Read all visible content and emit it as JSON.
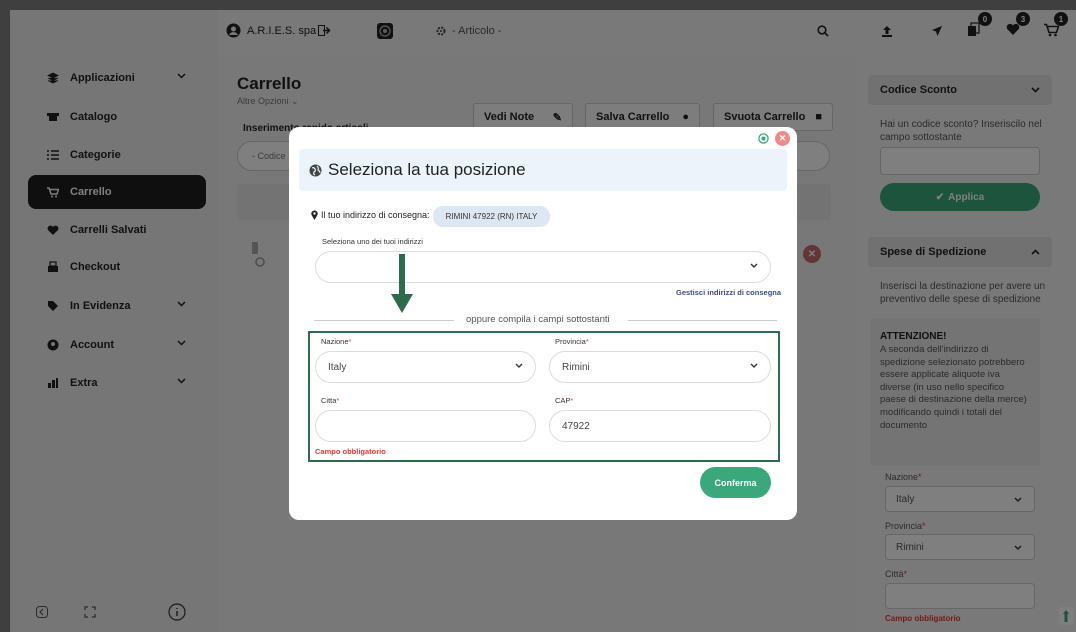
{
  "topbar": {
    "company": "A.R.I.E.S. spa",
    "article_placeholder": "- Articolo -"
  },
  "icons": {
    "cart_badge": "1",
    "wishlist_badge": "3",
    "compare_badge": "0"
  },
  "sidebar": {
    "items": [
      {
        "label": "Applicazioni",
        "icon": "layers-icon",
        "expandable": true
      },
      {
        "label": "Catalogo",
        "icon": "catalog-icon",
        "expandable": false
      },
      {
        "label": "Categorie",
        "icon": "list-icon",
        "expandable": false
      },
      {
        "label": "Carrello",
        "icon": "cart-icon",
        "expandable": false,
        "active": true
      },
      {
        "label": "Carrelli Salvati",
        "icon": "heart-icon",
        "expandable": false
      },
      {
        "label": "Checkout",
        "icon": "checkout-icon",
        "expandable": false
      },
      {
        "label": "In Evidenza",
        "icon": "tag-icon",
        "expandable": true
      },
      {
        "label": "Account",
        "icon": "user-icon",
        "expandable": true
      },
      {
        "label": "Extra",
        "icon": "extra-icon",
        "expandable": true
      }
    ]
  },
  "main": {
    "title": "Carrello",
    "subtitle": "Altre Opzioni",
    "quick_insert": "Inserimento rapido articoli",
    "code_placeholder": "- Codice",
    "buttons": {
      "notes": "Vedi Note",
      "save": "Salva Carrello",
      "empty": "Svuota Carrello"
    }
  },
  "right": {
    "discount_title": "Codice Sconto",
    "discount_text": "Hai un codice sconto? Inseriscilo nel campo sottostante",
    "apply": "Applica",
    "shipping_title": "Spese di Spedizione",
    "shipping_text": "Inserisci la destinazione per avere un preventivo delle spese di spedizione",
    "warning_title": "ATTENZIONE!",
    "warning_text": "A seconda dell'indirizzo di spedizione selezionato potrebbero essere applicate aliquote iva diverse (in uso nello specifico paese di destinazione della merce) modificando quindi i totali del documento",
    "nation_label": "Nazione",
    "nation_value": "Italy",
    "province_label": "Provincia",
    "province_value": "Rimini",
    "city_label": "Città",
    "required_error": "Campo obbligatorio"
  },
  "modal": {
    "title": "Seleziona la tua posizione",
    "delivery_label": "Il tuo indirizzo di consegna:",
    "delivery_value": "RIMINI 47922 (RN) ITALY",
    "select_label": "Seleziona uno dei tuoi indirizzi",
    "manage_link": "Gestisci indirizzi di consegna",
    "divider_text": "oppure compila i campi sottostanti",
    "nation_label": "Nazione",
    "nation_value": "Italy",
    "province_label": "Provincia",
    "province_value": "Rimini",
    "city_label": "Citta",
    "city_value": "",
    "cap_label": "CAP",
    "cap_value": "47922",
    "error": "Campo obbligatorio",
    "confirm": "Conferma"
  },
  "colors": {
    "accent_green": "#3aa87a",
    "dark_green": "#2e6b4d",
    "error_red": "#e53935"
  }
}
